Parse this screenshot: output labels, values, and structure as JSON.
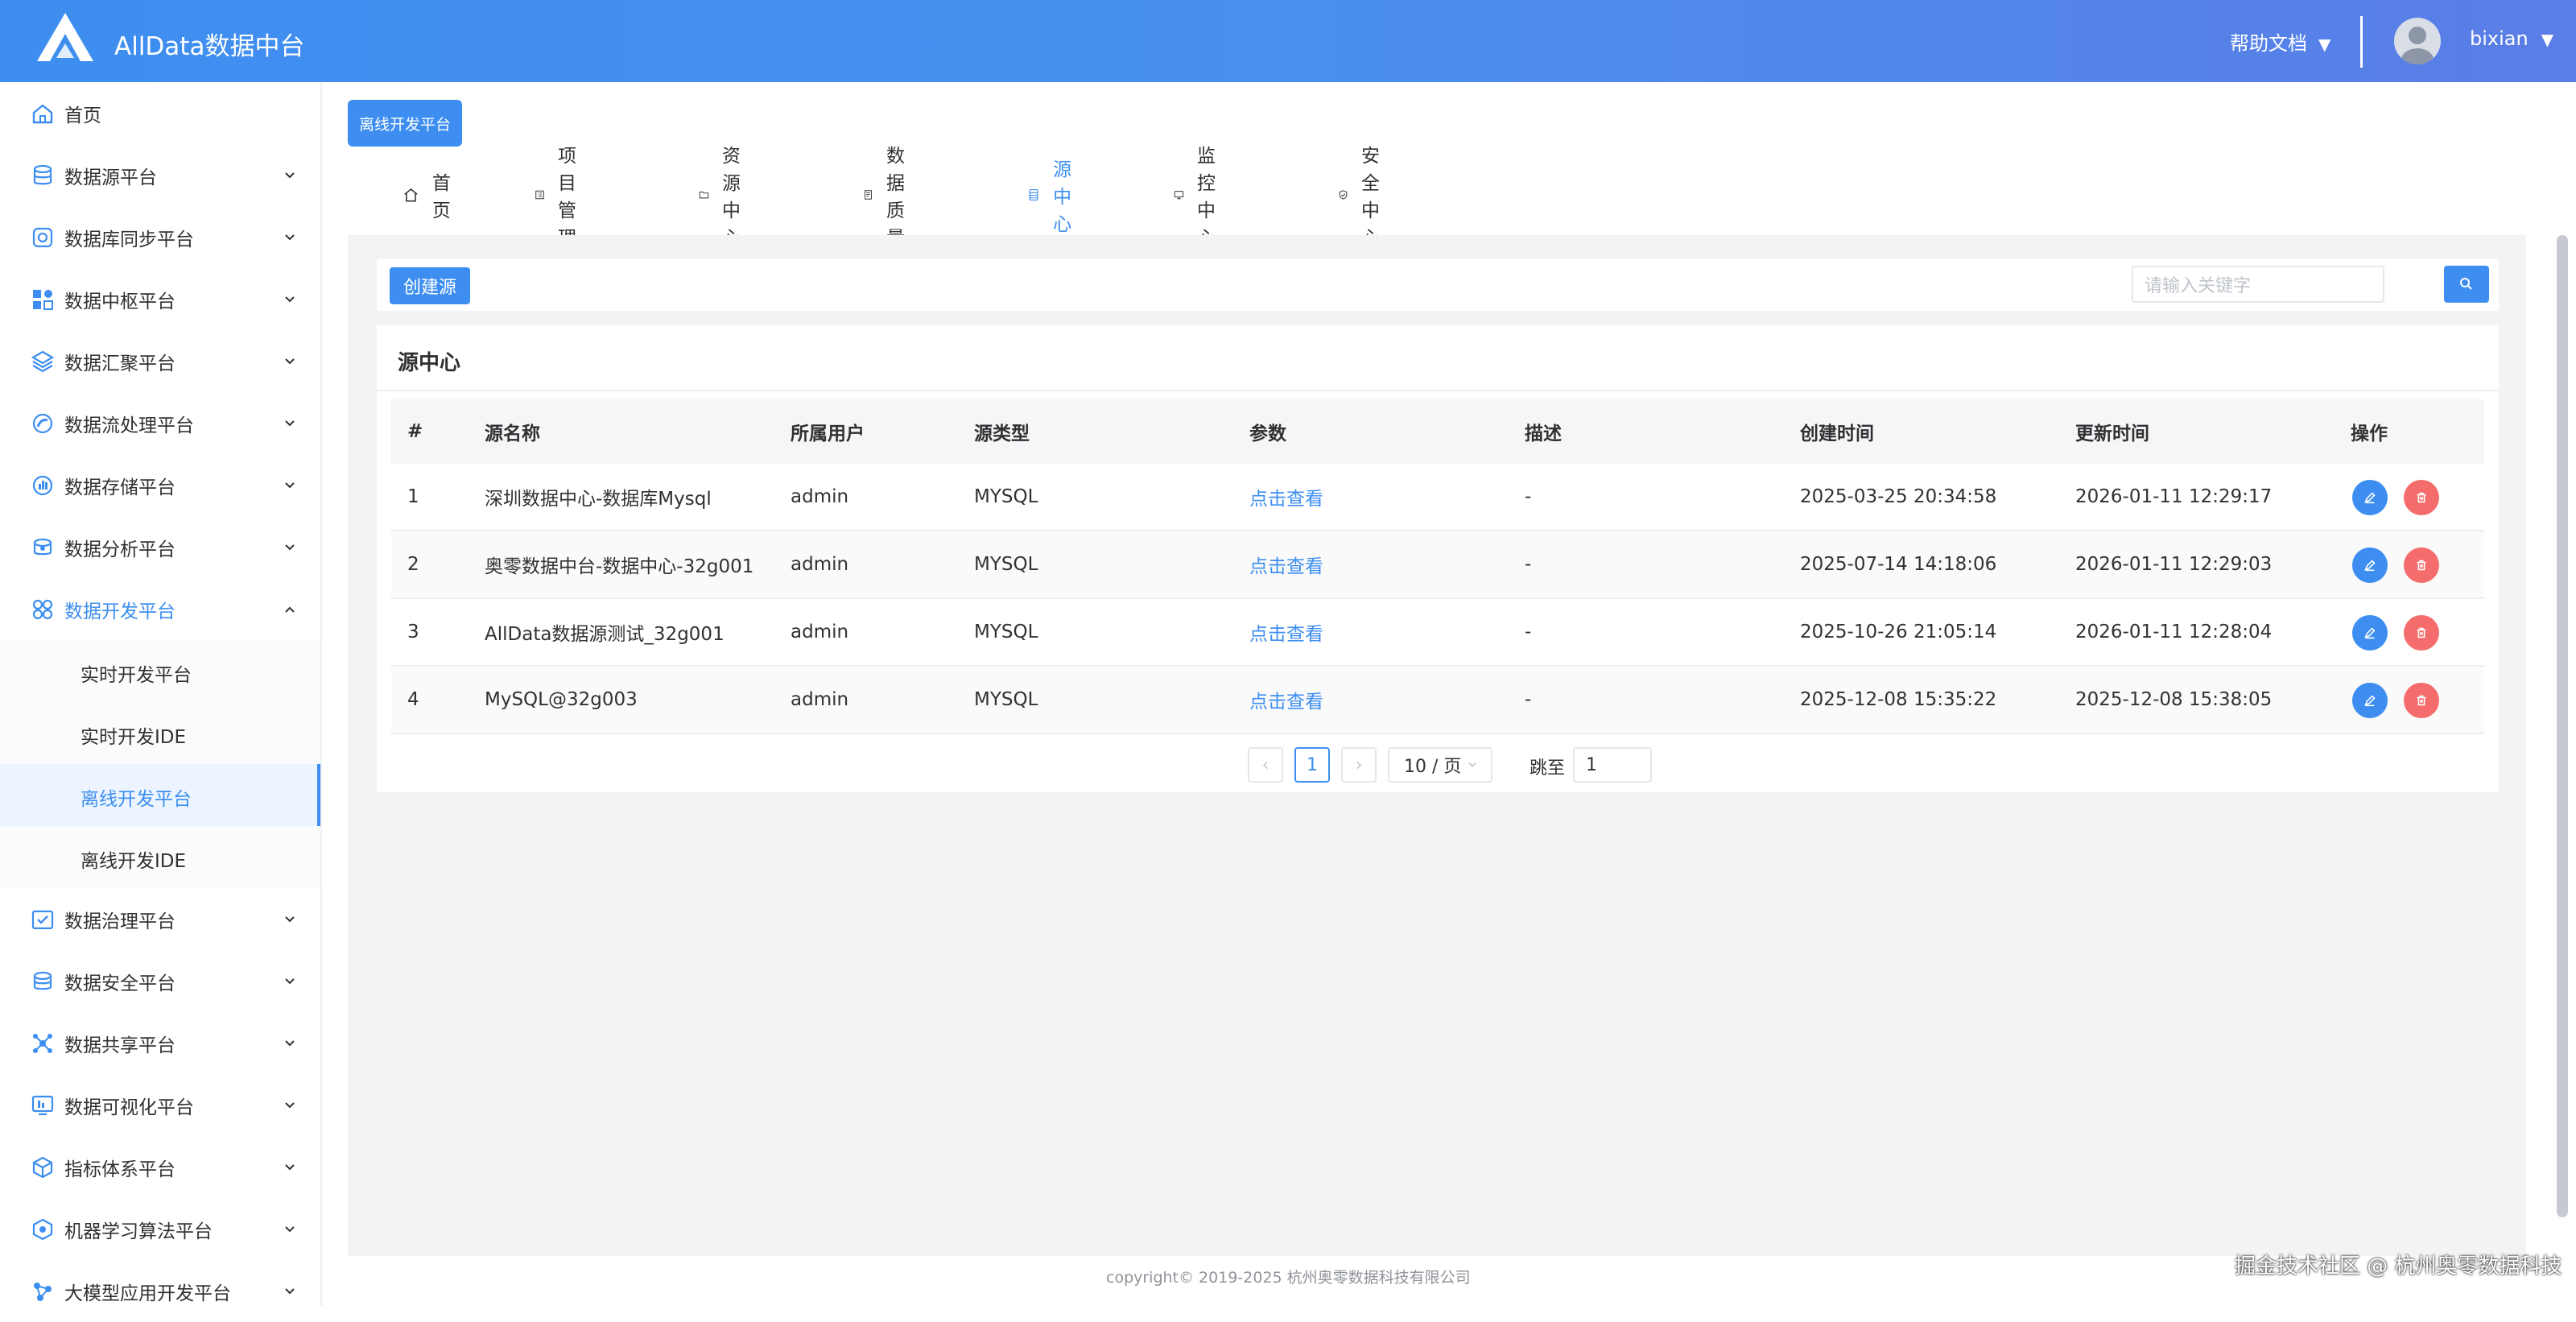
{
  "header": {
    "title": "AllData数据中台",
    "help_label": "帮助文档",
    "user_name": "bixian",
    "dropdown_glyph": "▼",
    "logo_icon": "alldata-logo-icon",
    "avatar_icon": "user-avatar-icon"
  },
  "sidebar": {
    "items": [
      {
        "label": "首页",
        "icon": "home-icon"
      },
      {
        "label": "数据源平台",
        "icon": "database-icon"
      },
      {
        "label": "数据库同步平台",
        "icon": "sync-icon"
      },
      {
        "label": "数据中枢平台",
        "icon": "hub-icon"
      },
      {
        "label": "数据汇聚平台",
        "icon": "layers-icon"
      },
      {
        "label": "数据流处理平台",
        "icon": "stream-icon"
      },
      {
        "label": "数据存储平台",
        "icon": "storage-icon"
      },
      {
        "label": "数据分析平台",
        "icon": "analysis-icon"
      },
      {
        "label": "数据开发平台",
        "icon": "dev-icon"
      },
      {
        "label": "数据治理平台",
        "icon": "governance-icon"
      },
      {
        "label": "数据安全平台",
        "icon": "security-icon"
      },
      {
        "label": "数据共享平台",
        "icon": "share-icon"
      },
      {
        "label": "数据可视化平台",
        "icon": "visual-icon"
      },
      {
        "label": "指标体系平台",
        "icon": "metrics-icon"
      },
      {
        "label": "机器学习算法平台",
        "icon": "ml-icon"
      },
      {
        "label": "大模型应用开发平台",
        "icon": "llm-icon"
      }
    ],
    "subitems": [
      {
        "label": "实时开发平台"
      },
      {
        "label": "实时开发IDE"
      },
      {
        "label": "离线开发平台"
      },
      {
        "label": "离线开发IDE"
      }
    ]
  },
  "main": {
    "tag_label": "离线开发平台",
    "tabs": [
      {
        "label": "首页",
        "icon": "home-icon"
      },
      {
        "label": "项目管理",
        "icon": "list-icon"
      },
      {
        "label": "资源中心",
        "icon": "folder-icon"
      },
      {
        "label": "数据质量",
        "icon": "document-icon"
      },
      {
        "label": "源中心",
        "icon": "database-list-icon"
      },
      {
        "label": "监控中心",
        "icon": "monitor-icon"
      },
      {
        "label": "安全中心",
        "icon": "shield-icon"
      }
    ],
    "create_label": "创建源",
    "search_placeholder": "请输入关键字",
    "card_title": "源中心",
    "columns": [
      "#",
      "源名称",
      "所属用户",
      "源类型",
      "参数",
      "描述",
      "创建时间",
      "更新时间",
      "操作"
    ],
    "rows": [
      [
        "1",
        "深圳数据中心-数据库Mysql",
        "admin",
        "MYSQL",
        "点击查看",
        "-",
        "2025-03-25 20:34:58",
        "2026-01-11 12:29:17"
      ],
      [
        "2",
        "奥零数据中台-数据中心-32g001",
        "admin",
        "MYSQL",
        "点击查看",
        "-",
        "2025-07-14 14:18:06",
        "2026-01-11 12:29:03"
      ],
      [
        "3",
        "AllData数据源测试_32g001",
        "admin",
        "MYSQL",
        "点击查看",
        "-",
        "2025-10-26 21:05:14",
        "2026-01-11 12:28:04"
      ],
      [
        "4",
        "MySQL@32g003",
        "admin",
        "MYSQL",
        "点击查看",
        "-",
        "2025-12-08 15:35:22",
        "2025-12-08 15:38:05"
      ]
    ],
    "pager": {
      "prev": "‹",
      "next": "›",
      "current": "1",
      "page_size": "10 / 页",
      "jump_label": "跳至",
      "jump_value": "1"
    }
  },
  "footer": "copyright© 2019-2025 杭州奥零数据科技有限公司",
  "watermark": "掘金技术社区 @ 杭州奥零数据科技",
  "colors": {
    "accent": "#3d8ef0",
    "danger": "#f56c6c"
  }
}
